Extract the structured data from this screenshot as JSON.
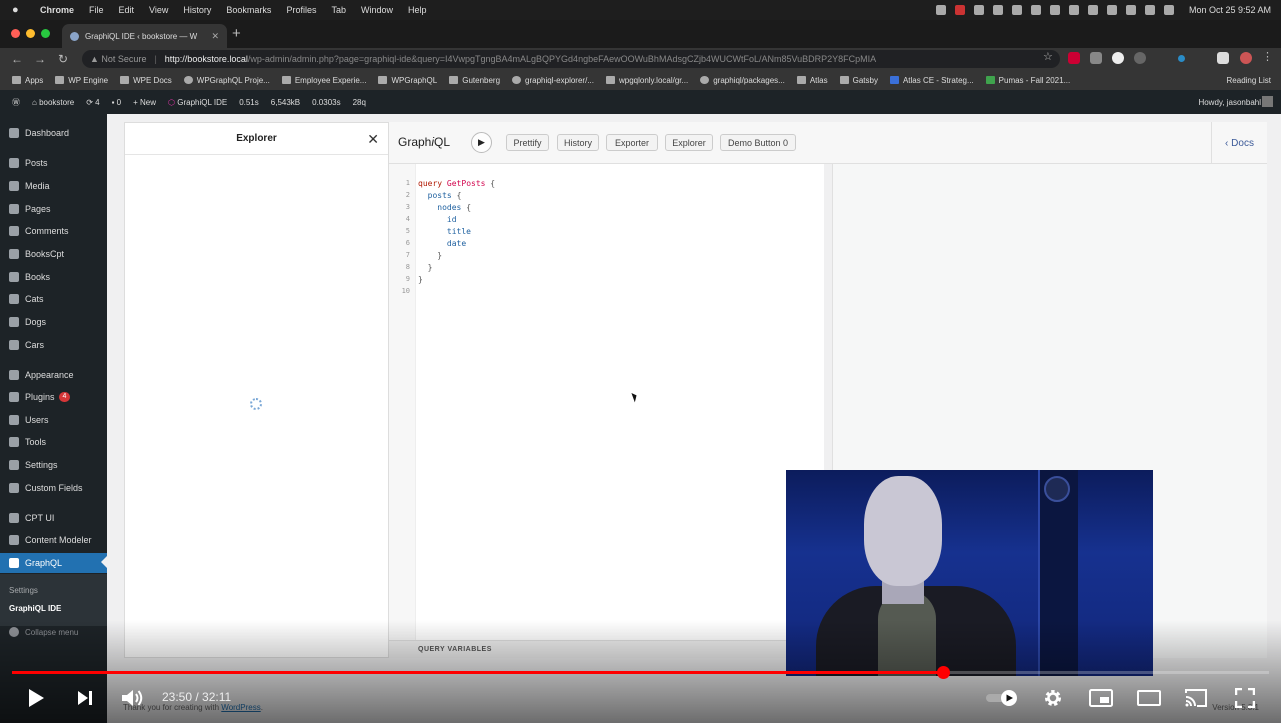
{
  "mac_menu": {
    "app": "Chrome",
    "items": [
      "File",
      "Edit",
      "View",
      "History",
      "Bookmarks",
      "Profiles",
      "Tab",
      "Window",
      "Help"
    ],
    "clock": "Mon Oct 25  9:52 AM"
  },
  "browser": {
    "tab_title": "GraphiQL IDE ‹ bookstore — W",
    "url_security": "Not Secure",
    "url_host": "http://bookstore.local",
    "url_path": "/wp-admin/admin.php?page=graphiql-ide&query=I4VwpgTgngBA4mALgBQPYGd4ngbeFAewOOWuBhMAdsgCZjb4WUCWtFoL/ANm85VuBDRP2Y8FCpMIA",
    "bookmarks": [
      "Apps",
      "WP Engine",
      "WPE Docs",
      "WPGraphQL Proje...",
      "Employee Experie...",
      "WPGraphQL",
      "Gutenberg",
      "graphiql-explorer/...",
      "wpgqlonly.local/gr...",
      "graphiql/packages...",
      "Atlas",
      "Gatsby",
      "Atlas CE - Strateg...",
      "Pumas - Fall 2021..."
    ],
    "reading_list": "Reading List"
  },
  "admin_bar": {
    "site": "bookstore",
    "updates": "4",
    "comments": "0",
    "new": "+ New",
    "graphiql": "GraphiQL IDE",
    "perf": [
      "0.51s",
      "6,543kB",
      "0.0303s",
      "28q"
    ],
    "howdy": "Howdy, jasonbahl"
  },
  "sidebar": {
    "items": [
      "Dashboard",
      "Posts",
      "Media",
      "Pages",
      "Comments",
      "BooksCpt",
      "Books",
      "Cats",
      "Dogs",
      "Cars",
      "Appearance",
      "Plugins",
      "Users",
      "Tools",
      "Settings",
      "Custom Fields",
      "CPT UI",
      "Content Modeler",
      "GraphQL"
    ],
    "plugins_badge": "4",
    "submenu": [
      "Settings",
      "GraphiQL IDE"
    ],
    "collapse": "Collapse menu"
  },
  "explorer": {
    "title": "Explorer",
    "close": "✕"
  },
  "graphiql": {
    "title_pre": "Graph",
    "title_i": "i",
    "title_post": "QL",
    "run": "▶",
    "buttons": [
      "Prettify",
      "History",
      "Exporter",
      "Explorer",
      "Demo Button 0"
    ],
    "docs": "Docs",
    "query_variables": "QUERY VARIABLES",
    "line_numbers": [
      "1",
      "2",
      "3",
      "4",
      "5",
      "6",
      "7",
      "8",
      "9",
      "10"
    ],
    "code": {
      "kw": "query",
      "op": "GetPosts",
      "posts": "posts",
      "nodes": "nodes",
      "id": "id",
      "title": "title",
      "date": "date",
      "open": "{",
      "close": "}"
    }
  },
  "footer": {
    "thanks": "Thank you for creating with",
    "link": "WordPress",
    "version": "Version 5.8.1"
  },
  "player": {
    "time": "23:50 / 32:11",
    "progress": 0.7405,
    "accent": "#ff0000"
  }
}
